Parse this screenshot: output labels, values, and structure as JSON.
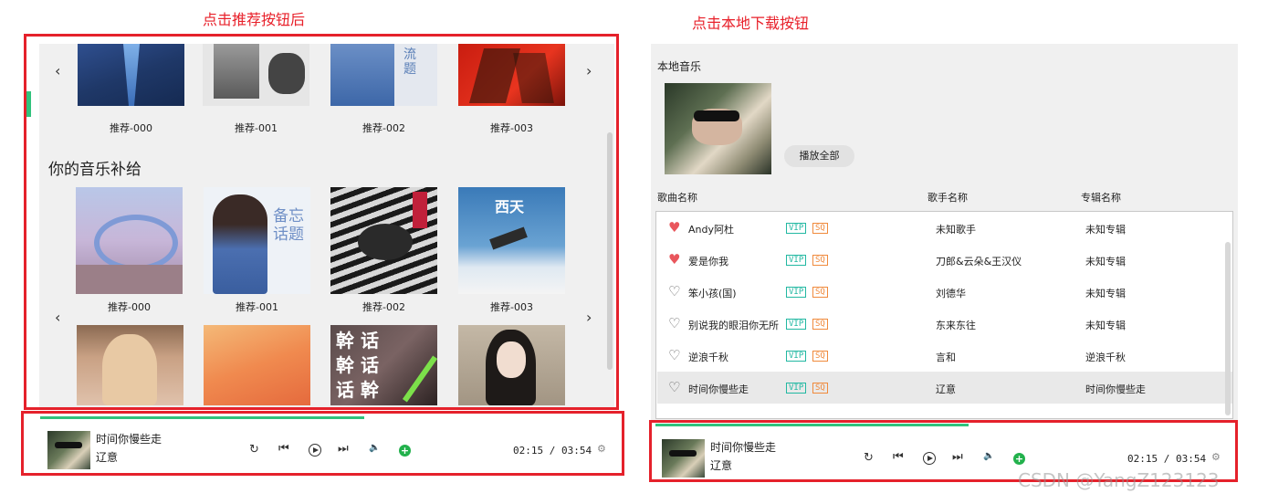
{
  "captions": {
    "left": "点击推荐按钮后",
    "right": "点击本地下载按钮"
  },
  "left_panel": {
    "top_row_labels": [
      "推荐-000",
      "推荐-001",
      "推荐-002",
      "推荐-003"
    ],
    "section_title": "你的音乐补给",
    "mid_row_labels": [
      "推荐-000",
      "推荐-001",
      "推荐-002",
      "推荐-003"
    ],
    "cover_texts": {
      "c6": "备忘\n话题",
      "c8": "西天",
      "c11": "幹 话\n幹 话\n话 幹"
    },
    "arrows": {
      "prev": "‹",
      "next": "›"
    }
  },
  "player_left": {
    "song": "时间你慢些走",
    "artist": "辽意",
    "time": "02:15 / 03:54",
    "progress": 0.58
  },
  "right_panel": {
    "title": "本地音乐",
    "play_all": "播放全部",
    "headers": {
      "song": "歌曲名称",
      "artist": "歌手名称",
      "album": "专辑名称"
    },
    "tag_vip": "VIP",
    "tag_sq": "SQ",
    "songs": [
      {
        "name": "Andy阿杜",
        "artist": "未知歌手",
        "album": "未知专辑",
        "liked": true
      },
      {
        "name": "爱是你我",
        "artist": "刀郎&云朵&王汉仪",
        "album": "未知专辑",
        "liked": true
      },
      {
        "name": "笨小孩(国)",
        "artist": "刘德华",
        "album": "未知专辑",
        "liked": false
      },
      {
        "name": "别说我的眼泪你无所",
        "artist": "东来东往",
        "album": "未知专辑",
        "liked": false
      },
      {
        "name": "逆浪千秋",
        "artist": "言和",
        "album": "逆浪千秋",
        "liked": false
      },
      {
        "name": "时间你慢些走",
        "artist": "辽意",
        "album": "时间你慢些走",
        "liked": false
      }
    ]
  },
  "player_right": {
    "song": "时间你慢些走",
    "artist": "辽意",
    "time": "02:15 / 03:54",
    "progress": 0.56
  },
  "icons": {
    "loop": "↻",
    "prev": "⏮",
    "next": "⏭",
    "volume": "🔈",
    "add": "+",
    "settings": "⚙",
    "heart_filled": "♥",
    "heart_empty": "♡"
  },
  "watermark": "CSDN @YangZ123123",
  "colors": {
    "accent_green": "#31c27c",
    "red_border": "#e5212b",
    "vip": "#22b8a2",
    "sq": "#f08a3c",
    "heart": "#e9565c"
  }
}
